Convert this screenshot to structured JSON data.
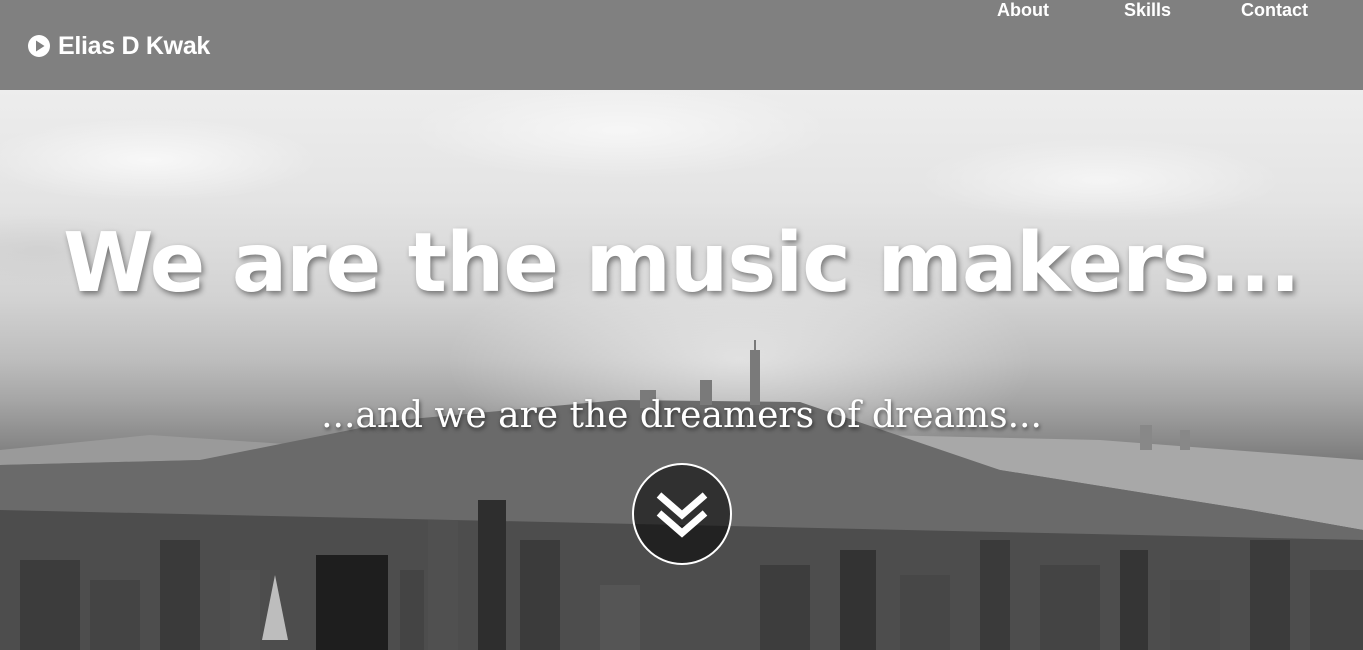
{
  "navbar": {
    "brand_label": "Elias D Kwak",
    "brand_icon": "play-circle-icon",
    "links": [
      {
        "label": "About"
      },
      {
        "label": "Skills"
      },
      {
        "label": "Contact"
      }
    ]
  },
  "hero": {
    "headline": "We are the music makers...",
    "subheadline": "...and we are the dreamers of dreams...",
    "scroll_icon": "double-chevron-down-icon"
  },
  "colors": {
    "navbar_bg": "#808080",
    "text": "#ffffff"
  }
}
